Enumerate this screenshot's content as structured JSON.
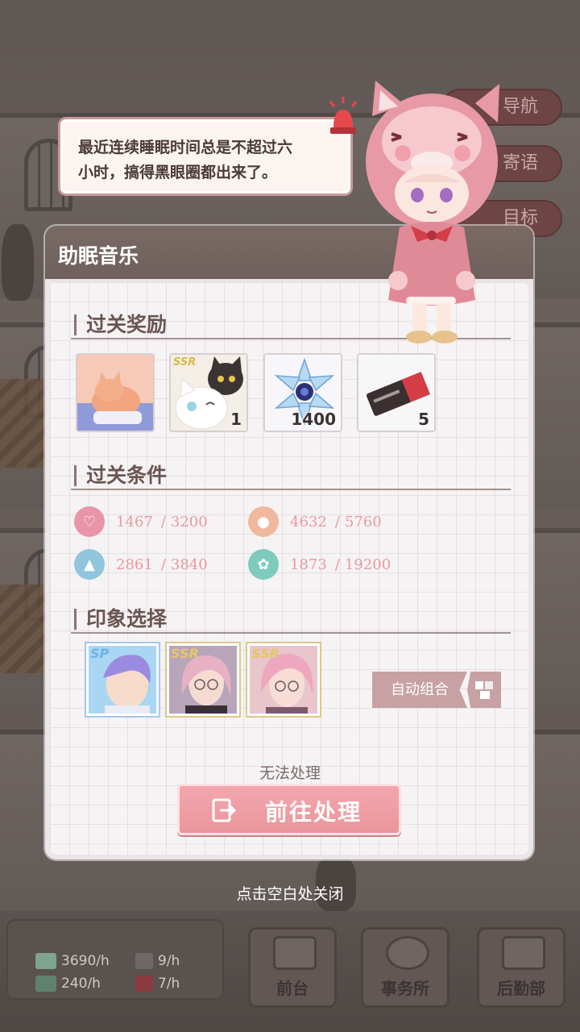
{
  "speech": {
    "text_line1": "最近连续睡眠时间总是不超过六",
    "text_line2": "小时，搞得黑眼圈都出来了。"
  },
  "side_buttons": [
    {
      "label": "导航"
    },
    {
      "label": "寄语"
    },
    {
      "label": "目标"
    }
  ],
  "panel": {
    "title": "助眠音乐",
    "rewards_title": "过关奖励",
    "rewards": [
      {
        "name": "sleeping-cat-cg",
        "count": ""
      },
      {
        "name": "ssr-cat-card",
        "rarity": "SSR",
        "count": "1"
      },
      {
        "name": "crystal-snowflake",
        "count": "1400"
      },
      {
        "name": "red-ticket",
        "count": "5"
      }
    ],
    "conditions_title": "过关条件",
    "conditions": [
      {
        "icon": "heartbeat-icon",
        "current": "1467",
        "target": "3200",
        "color": "#e995a9"
      },
      {
        "icon": "person-icon",
        "current": "4632",
        "target": "5760",
        "color": "#f0b99e"
      },
      {
        "icon": "graduation-cap-icon",
        "current": "2861",
        "target": "3840",
        "color": "#90c5dd"
      },
      {
        "icon": "flower-icon",
        "current": "1873",
        "target": "19200",
        "color": "#7ecbbd"
      }
    ],
    "impression_title": "印象选择",
    "cards": [
      {
        "rarity": "SP",
        "name": "purple-hair-card"
      },
      {
        "rarity": "SSR",
        "name": "pink-hair-glasses-card-1"
      },
      {
        "rarity": "SSR",
        "name": "pink-hair-glasses-card-2"
      }
    ],
    "auto_label": "自动组合",
    "unable_text": "无法处理",
    "go_label": "前往处理"
  },
  "close_hint": "点击空白处关闭",
  "resources": [
    {
      "icon": "cash-icon",
      "value": "3690/h"
    },
    {
      "icon": "gift-box-icon",
      "value": "9/h"
    },
    {
      "icon": "books-icon",
      "value": "240/h"
    },
    {
      "icon": "present-icon",
      "value": "7/h"
    }
  ],
  "bottom_nav": [
    {
      "label": "前台"
    },
    {
      "label": "事务所"
    },
    {
      "label": "后勤部"
    }
  ]
}
